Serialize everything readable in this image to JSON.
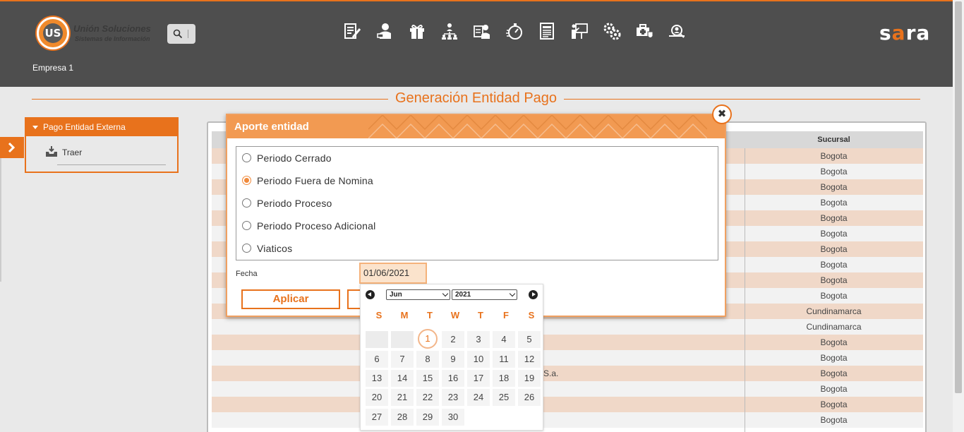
{
  "header": {
    "logo_line1": "Unión Soluciones",
    "logo_line2": "Sistemas de Información",
    "logo_mark": "US",
    "brand": "sara",
    "company": "Empresa 1",
    "nav_icons": [
      "document-edit-icon",
      "user-hand-icon",
      "gift-icon",
      "org-chart-icon",
      "user-id-icon",
      "stopwatch-icon",
      "list-document-icon",
      "presentation-icon",
      "gears-icon",
      "medical-case-icon",
      "user-search-icon"
    ]
  },
  "page": {
    "title": "Generación Entidad Pago"
  },
  "sidebar": {
    "section_label": "Pago Entidad Externa",
    "items": [
      {
        "label": "Traer",
        "icon": "inbox-download-icon"
      }
    ]
  },
  "grid": {
    "column_header": "Sucursal",
    "rows": [
      {
        "sucursal": "Bogota",
        "name": ""
      },
      {
        "sucursal": "Bogota",
        "name": ""
      },
      {
        "sucursal": "Bogota",
        "name": ""
      },
      {
        "sucursal": "Bogota",
        "name": ""
      },
      {
        "sucursal": "Bogota",
        "name": ""
      },
      {
        "sucursal": "Bogota",
        "name": ""
      },
      {
        "sucursal": "Bogota",
        "name": ""
      },
      {
        "sucursal": "Bogota",
        "name": ""
      },
      {
        "sucursal": "Bogota",
        "name": ""
      },
      {
        "sucursal": "Bogota",
        "name": ""
      },
      {
        "sucursal": "Cundinamarca",
        "name": ""
      },
      {
        "sucursal": "Cundinamarca",
        "name": ""
      },
      {
        "sucursal": "Bogota",
        "name": ""
      },
      {
        "sucursal": "Bogota",
        "name": ""
      },
      {
        "sucursal": "Bogota",
        "name": "a S.a."
      },
      {
        "sucursal": "Bogota",
        "name": ""
      },
      {
        "sucursal": "Bogota",
        "name": ""
      },
      {
        "sucursal": "Bogota",
        "name": ""
      }
    ]
  },
  "modal": {
    "title": "Aporte entidad",
    "options": [
      {
        "label": "Periodo Cerrado",
        "selected": false
      },
      {
        "label": "Periodo Fuera de Nomina",
        "selected": true
      },
      {
        "label": "Periodo Proceso",
        "selected": false
      },
      {
        "label": "Periodo Proceso Adicional",
        "selected": false
      },
      {
        "label": "Viaticos",
        "selected": false
      }
    ],
    "fecha_label": "Fecha",
    "fecha_value": "01/06/2021",
    "apply_label": "Aplicar",
    "second_button_label": ""
  },
  "datepicker": {
    "month": "Jun",
    "year": "2021",
    "weekdays": [
      "S",
      "M",
      "T",
      "W",
      "T",
      "F",
      "S"
    ],
    "weeks": [
      [
        "",
        "",
        "1",
        "2",
        "3",
        "4",
        "5"
      ],
      [
        "6",
        "7",
        "8",
        "9",
        "10",
        "11",
        "12"
      ],
      [
        "13",
        "14",
        "15",
        "16",
        "17",
        "18",
        "19"
      ],
      [
        "20",
        "21",
        "22",
        "23",
        "24",
        "25",
        "26"
      ],
      [
        "27",
        "28",
        "29",
        "30",
        "",
        "",
        ""
      ]
    ],
    "selected_day": "1"
  },
  "colors": {
    "accent": "#e8721c",
    "header_bg": "#4e4e4e",
    "modal_header": "#f29a52",
    "row_alt": "#f0d8c8"
  }
}
